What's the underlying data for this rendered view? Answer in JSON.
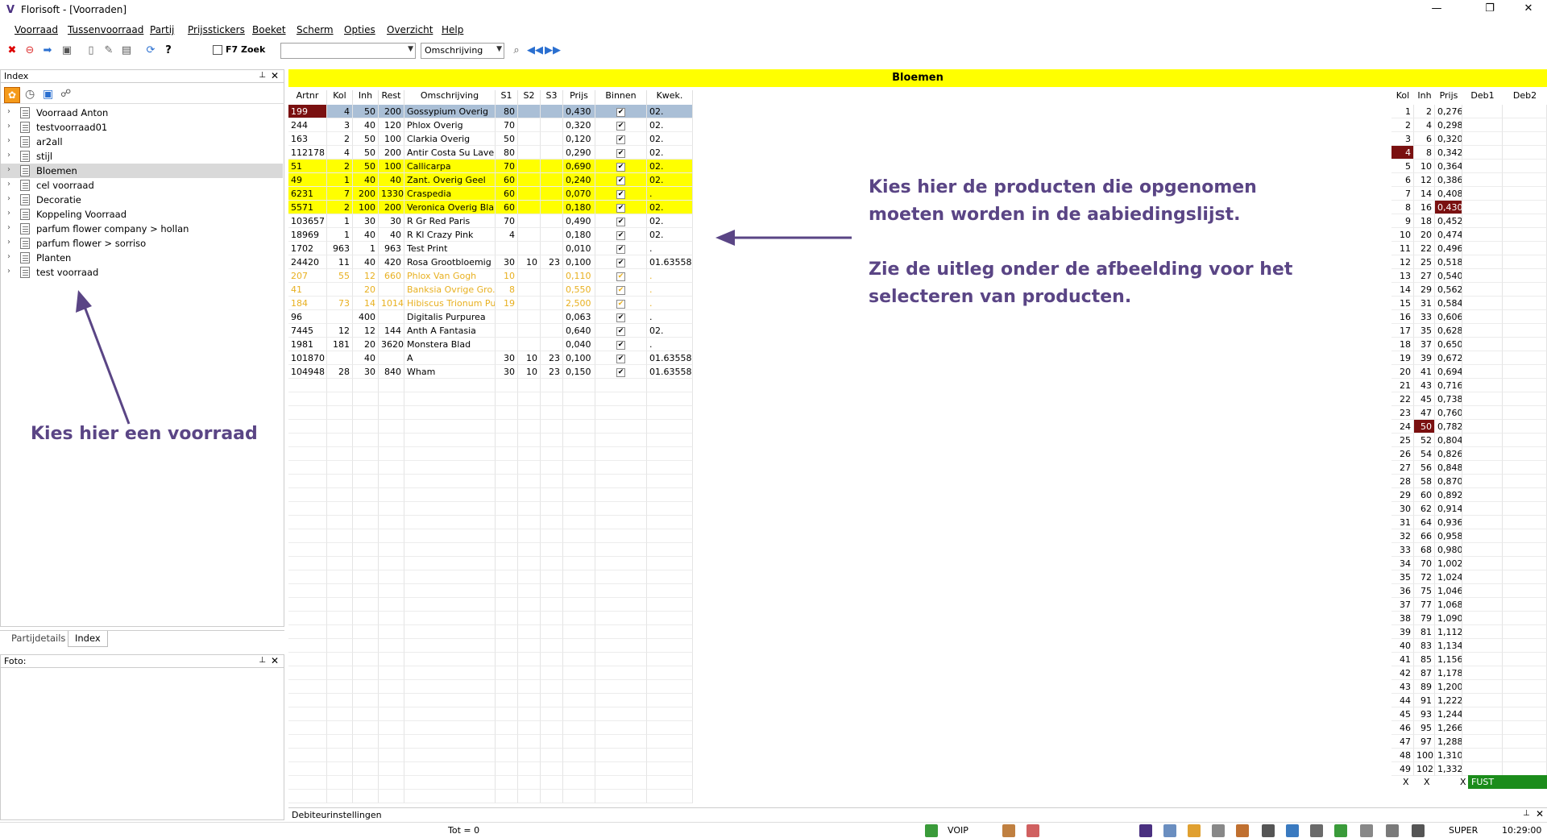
{
  "window": {
    "title": "Florisoft - [Voorraden]",
    "minimize": "—",
    "restore": "❐",
    "close": "✕"
  },
  "menu": [
    "Voorraad",
    "Tussenvoorraad",
    "Partij",
    "Prijsstickers",
    "Boeket",
    "Scherm",
    "Opties",
    "Overzicht",
    "Help"
  ],
  "toolbar": {
    "f7_label": "F7 Zoek",
    "search_value": "",
    "field_select": "Omschrijving"
  },
  "index_panel": {
    "title": "Index",
    "items": [
      "Voorraad Anton",
      "testvoorraad01",
      "ar2all",
      "stijl",
      "Bloemen",
      "cel voorraad",
      "Decoratie",
      "Koppeling Voorraad",
      "parfum flower company > hollan",
      "parfum flower > sorriso",
      "Planten",
      "test voorraad"
    ],
    "selected": "Bloemen"
  },
  "bottom_tabs": [
    "Partijdetails",
    "Index"
  ],
  "foto_panel": {
    "title": "Foto:"
  },
  "grid": {
    "title": "Bloemen",
    "headers": [
      "Artnr",
      "Kol",
      "Inh",
      "Rest",
      "Omschrijving",
      "S1",
      "S2",
      "S3",
      "Prijs",
      "Binnen",
      "Kwek."
    ],
    "rows": [
      {
        "artnr": "199",
        "kol": "4",
        "inh": "50",
        "rest": "200",
        "oms": "Gossypium Overig",
        "s1": "80",
        "s2": "",
        "s3": "",
        "prijs": "0,430",
        "binnen": true,
        "kwek": "02.",
        "style": "selected"
      },
      {
        "artnr": "244",
        "kol": "3",
        "inh": "40",
        "rest": "120",
        "oms": "Phlox Overig",
        "s1": "70",
        "s2": "",
        "s3": "",
        "prijs": "0,320",
        "binnen": true,
        "kwek": "02.",
        "style": ""
      },
      {
        "artnr": "163",
        "kol": "2",
        "inh": "50",
        "rest": "100",
        "oms": "Clarkia Overig",
        "s1": "50",
        "s2": "",
        "s3": "",
        "prijs": "0,120",
        "binnen": true,
        "kwek": "02.",
        "style": ""
      },
      {
        "artnr": "112178",
        "kol": "4",
        "inh": "50",
        "rest": "200",
        "oms": "Antir Costa Su Laven",
        "s1": "80",
        "s2": "",
        "s3": "",
        "prijs": "0,290",
        "binnen": true,
        "kwek": "02.",
        "style": ""
      },
      {
        "artnr": "51",
        "kol": "2",
        "inh": "50",
        "rest": "100",
        "oms": "Callicarpa",
        "s1": "70",
        "s2": "",
        "s3": "",
        "prijs": "0,690",
        "binnen": true,
        "kwek": "02.",
        "style": "yellow"
      },
      {
        "artnr": "49",
        "kol": "1",
        "inh": "40",
        "rest": "40",
        "oms": "Zant. Overig Geel",
        "s1": "60",
        "s2": "",
        "s3": "",
        "prijs": "0,240",
        "binnen": true,
        "kwek": "02.",
        "style": "yellow"
      },
      {
        "artnr": "6231",
        "kol": "7",
        "inh": "200",
        "rest": "1330",
        "oms": "Craspedia",
        "s1": "60",
        "s2": "",
        "s3": "",
        "prijs": "0,070",
        "binnen": true,
        "kwek": ".",
        "style": "yellow"
      },
      {
        "artnr": "5571",
        "kol": "2",
        "inh": "100",
        "rest": "200",
        "oms": "Veronica Overig Blauw",
        "s1": "60",
        "s2": "",
        "s3": "",
        "prijs": "0,180",
        "binnen": true,
        "kwek": "02.",
        "style": "yellow"
      },
      {
        "artnr": "103657",
        "kol": "1",
        "inh": "30",
        "rest": "30",
        "oms": "R Gr Red Paris",
        "s1": "70",
        "s2": "",
        "s3": "",
        "prijs": "0,490",
        "binnen": true,
        "kwek": "02.",
        "style": ""
      },
      {
        "artnr": "18969",
        "kol": "1",
        "inh": "40",
        "rest": "40",
        "oms": "R Kl Crazy Pink",
        "s1": "4",
        "s2": "",
        "s3": "",
        "prijs": "0,180",
        "binnen": true,
        "kwek": "02.",
        "style": ""
      },
      {
        "artnr": "1702",
        "kol": "963",
        "inh": "1",
        "rest": "963",
        "oms": "Test Print",
        "s1": "",
        "s2": "",
        "s3": "",
        "prijs": "0,010",
        "binnen": true,
        "kwek": ".",
        "style": ""
      },
      {
        "artnr": "24420",
        "kol": "11",
        "inh": "40",
        "rest": "420",
        "oms": "Rosa Grootbloemig ...",
        "s1": "30",
        "s2": "10",
        "s3": "23",
        "prijs": "0,100",
        "binnen": true,
        "kwek": "01.63558",
        "style": ""
      },
      {
        "artnr": "207",
        "kol": "55",
        "inh": "12",
        "rest": "660",
        "oms": "Phlox Van Gogh",
        "s1": "10",
        "s2": "",
        "s3": "",
        "prijs": "0,110",
        "binnen": true,
        "kwek": ".",
        "style": "faded"
      },
      {
        "artnr": "41",
        "kol": "",
        "inh": "20",
        "rest": "",
        "oms": "Banksia Ovrige Gro...",
        "s1": "8",
        "s2": "",
        "s3": "",
        "prijs": "0,550",
        "binnen": true,
        "kwek": ".",
        "style": "faded"
      },
      {
        "artnr": "184",
        "kol": "73",
        "inh": "14",
        "rest": "1014",
        "oms": "Hibiscus Trionum Pu...",
        "s1": "19",
        "s2": "",
        "s3": "",
        "prijs": "2,500",
        "binnen": true,
        "kwek": ".",
        "style": "faded"
      },
      {
        "artnr": "96",
        "kol": "",
        "inh": "400",
        "rest": "",
        "oms": "Digitalis Purpurea",
        "s1": "",
        "s2": "",
        "s3": "",
        "prijs": "0,063",
        "binnen": true,
        "kwek": ".",
        "style": ""
      },
      {
        "artnr": "7445",
        "kol": "12",
        "inh": "12",
        "rest": "144",
        "oms": "Anth A Fantasia",
        "s1": "",
        "s2": "",
        "s3": "",
        "prijs": "0,640",
        "binnen": true,
        "kwek": "02.",
        "style": ""
      },
      {
        "artnr": "1981",
        "kol": "181",
        "inh": "20",
        "rest": "3620",
        "oms": "Monstera Blad",
        "s1": "",
        "s2": "",
        "s3": "",
        "prijs": "0,040",
        "binnen": true,
        "kwek": ".",
        "style": ""
      },
      {
        "artnr": "101870",
        "kol": "",
        "inh": "40",
        "rest": "",
        "oms": "A",
        "s1": "30",
        "s2": "10",
        "s3": "23",
        "prijs": "0,100",
        "binnen": true,
        "kwek": "01.63558",
        "style": ""
      },
      {
        "artnr": "104948",
        "kol": "28",
        "inh": "30",
        "rest": "840",
        "oms": "Wham",
        "s1": "30",
        "s2": "10",
        "s3": "23",
        "prijs": "0,150",
        "binnen": true,
        "kwek": "01.63558",
        "style": ""
      }
    ]
  },
  "price_table": {
    "headers": [
      "Kol",
      "Inh",
      "Prijs",
      "Deb1",
      "Deb2"
    ],
    "rows": [
      [
        "1",
        "2",
        "0,276"
      ],
      [
        "2",
        "4",
        "0,298"
      ],
      [
        "3",
        "6",
        "0,320"
      ],
      [
        "4",
        "8",
        "0,342"
      ],
      [
        "5",
        "10",
        "0,364"
      ],
      [
        "6",
        "12",
        "0,386"
      ],
      [
        "7",
        "14",
        "0,408"
      ],
      [
        "8",
        "16",
        "0,430"
      ],
      [
        "9",
        "18",
        "0,452"
      ],
      [
        "10",
        "20",
        "0,474"
      ],
      [
        "11",
        "22",
        "0,496"
      ],
      [
        "12",
        "25",
        "0,518"
      ],
      [
        "13",
        "27",
        "0,540"
      ],
      [
        "14",
        "29",
        "0,562"
      ],
      [
        "15",
        "31",
        "0,584"
      ],
      [
        "16",
        "33",
        "0,606"
      ],
      [
        "17",
        "35",
        "0,628"
      ],
      [
        "18",
        "37",
        "0,650"
      ],
      [
        "19",
        "39",
        "0,672"
      ],
      [
        "20",
        "41",
        "0,694"
      ],
      [
        "21",
        "43",
        "0,716"
      ],
      [
        "22",
        "45",
        "0,738"
      ],
      [
        "23",
        "47",
        "0,760"
      ],
      [
        "24",
        "50",
        "0,782"
      ],
      [
        "25",
        "52",
        "0,804"
      ],
      [
        "26",
        "54",
        "0,826"
      ],
      [
        "27",
        "56",
        "0,848"
      ],
      [
        "28",
        "58",
        "0,870"
      ],
      [
        "29",
        "60",
        "0,892"
      ],
      [
        "30",
        "62",
        "0,914"
      ],
      [
        "31",
        "64",
        "0,936"
      ],
      [
        "32",
        "66",
        "0,958"
      ],
      [
        "33",
        "68",
        "0,980"
      ],
      [
        "34",
        "70",
        "1,002"
      ],
      [
        "35",
        "72",
        "1,024"
      ],
      [
        "36",
        "75",
        "1,046"
      ],
      [
        "37",
        "77",
        "1,068"
      ],
      [
        "38",
        "79",
        "1,090"
      ],
      [
        "39",
        "81",
        "1,112"
      ],
      [
        "40",
        "83",
        "1,134"
      ],
      [
        "41",
        "85",
        "1,156"
      ],
      [
        "42",
        "87",
        "1,178"
      ],
      [
        "43",
        "89",
        "1,200"
      ],
      [
        "44",
        "91",
        "1,222"
      ],
      [
        "45",
        "93",
        "1,244"
      ],
      [
        "46",
        "95",
        "1,266"
      ],
      [
        "47",
        "97",
        "1,288"
      ],
      [
        "48",
        "100",
        "1,310"
      ],
      [
        "49",
        "102",
        "1,332"
      ]
    ],
    "footer": [
      "X",
      "X",
      "X",
      "FUST"
    ]
  },
  "annotations": {
    "products_line1": "Kies hier de producten die opgenomen",
    "products_line2": "moeten worden in de aabiedingslijst.",
    "explain_line1": "Zie de uitleg onder de afbeelding voor het",
    "explain_line2": "selecteren van producten.",
    "stock": "Kies hier een voorraad"
  },
  "debiteur_bar": {
    "label": "Debiteurinstellingen"
  },
  "status": {
    "total": "Tot = 0",
    "voip": "VOIP",
    "user": "SUPER",
    "time": "10:29:00"
  },
  "colors": {
    "yellow": "#ffff00",
    "selected_row": "#aabfd6",
    "dark_red": "#7a1010",
    "annotation": "#5a4585",
    "fust_green": "#1b8c1b"
  }
}
